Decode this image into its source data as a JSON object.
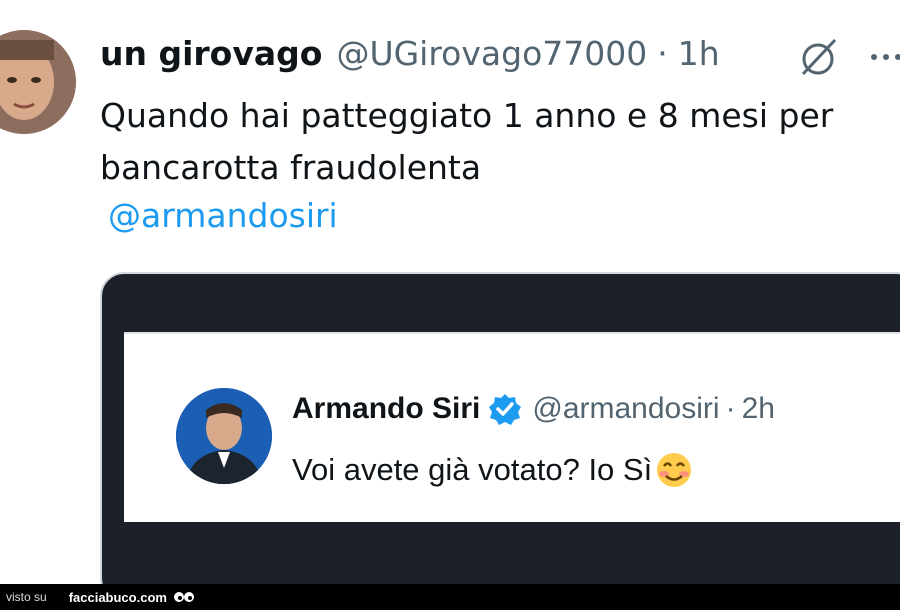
{
  "tweet": {
    "author_name": "un girovago",
    "author_handle": "@UGirovago77000",
    "separator": "·",
    "time": "1h",
    "text": "Quando hai patteggiato 1 anno e 8 mesi per bancarotta fraudolenta",
    "mention": "@armandosiri",
    "icons": {
      "grok": "grok-icon",
      "more": "more-icon"
    }
  },
  "quoted": {
    "author_name": "Armando Siri",
    "author_handle": "@armandosiri",
    "separator": "·",
    "time": "2h",
    "text": "Voi avete già votato? Io Sì",
    "verified": true,
    "emoji": "smiling-face-icon"
  },
  "watermark": {
    "prefix": "visto su",
    "site": "facciabuco.com"
  },
  "colors": {
    "link": "#1d9bf0",
    "secondary_text": "#536471",
    "verified": "#1d9bf0",
    "media_background": "#1c2028"
  }
}
